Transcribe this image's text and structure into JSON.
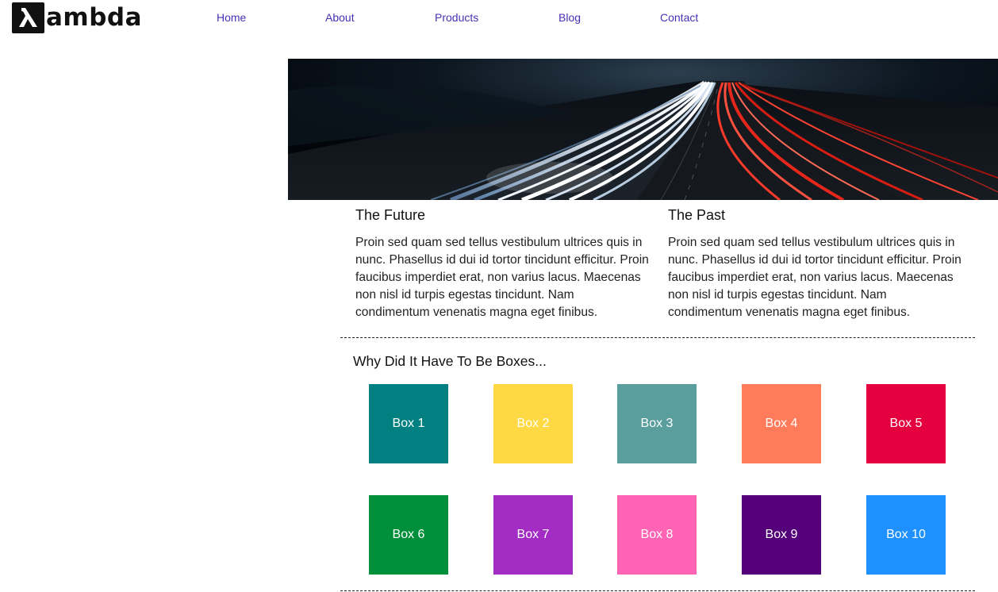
{
  "header": {
    "logo_text": "ambda",
    "logo_icon": "lambda-icon",
    "nav": [
      "Home",
      "About",
      "Products",
      "Blog",
      "Contact"
    ]
  },
  "hero": {
    "image": "highway-light-trails-at-night"
  },
  "content": {
    "future": {
      "title": "The Future",
      "body": "Proin sed quam sed tellus vestibulum ultrices quis in nunc. Phasellus id dui id tortor tincidunt efficitur. Proin faucibus imperdiet erat, non varius lacus. Maecenas non nisl id turpis egestas tincidunt. Nam condimentum venenatis magna eget finibus."
    },
    "past": {
      "title": "The Past",
      "body": "Proin sed quam sed tellus vestibulum ultrices quis in nunc. Phasellus id dui id tortor tincidunt efficitur. Proin faucibus imperdiet erat, non varius lacus. Maecenas non nisl id turpis egestas tincidunt. Nam condimentum venenatis magna eget finibus."
    }
  },
  "boxes": {
    "heading": "Why Did It Have To Be Boxes...",
    "items": [
      {
        "label": "Box 1",
        "color": "#008080"
      },
      {
        "label": "Box 2",
        "color": "#FFD944"
      },
      {
        "label": "Box 3",
        "color": "#5A9E9E"
      },
      {
        "label": "Box 4",
        "color": "#FF7B5A"
      },
      {
        "label": "Box 5",
        "color": "#E4003F"
      },
      {
        "label": "Box 6",
        "color": "#008F3A"
      },
      {
        "label": "Box 7",
        "color": "#A32CC4"
      },
      {
        "label": "Box 8",
        "color": "#FF64B4"
      },
      {
        "label": "Box 9",
        "color": "#53007A"
      },
      {
        "label": "Box 10",
        "color": "#1E90FF"
      }
    ]
  }
}
